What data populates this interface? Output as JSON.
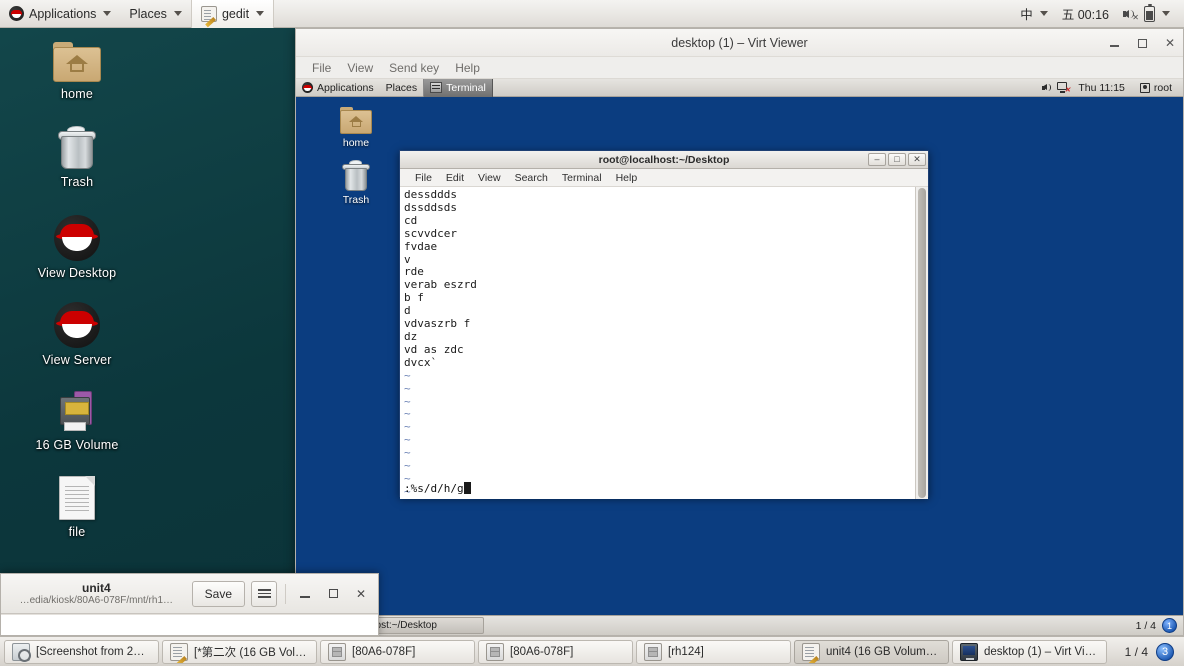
{
  "host_panel": {
    "logo_icon": "redhat-logo-icon",
    "applications": "Applications",
    "places": "Places",
    "active_app": "gedit",
    "ime": "中",
    "clock": "五 00:16",
    "speaker_icon": "speaker-muted-icon",
    "battery_icon": "battery-icon"
  },
  "desktop_icons": [
    {
      "label": "home",
      "icon": "home-folder-icon"
    },
    {
      "label": "Trash",
      "icon": "trash-icon"
    },
    {
      "label": "View Desktop",
      "icon": "redhat-logo-icon"
    },
    {
      "label": "View Server",
      "icon": "redhat-logo-icon"
    },
    {
      "label": "16 GB Volume",
      "icon": "usb-volume-icon"
    },
    {
      "label": "file",
      "icon": "text-file-icon"
    }
  ],
  "virt_viewer": {
    "title": "desktop (1) – Virt Viewer",
    "menu": [
      "File",
      "View",
      "Send key",
      "Help"
    ],
    "buttons": {
      "minimize": "–",
      "maximize": "□",
      "close": "✕"
    }
  },
  "vm": {
    "panel": {
      "applications": "Applications",
      "places": "Places",
      "active_window": "Terminal",
      "clock": "Thu 11:15",
      "user": "root",
      "speaker_icon": "speaker-icon",
      "network_icon": "network-disconnected-icon",
      "user_icon": "user-icon"
    },
    "desktop_icons": [
      {
        "label": "home",
        "icon": "home-folder-icon"
      },
      {
        "label": "Trash",
        "icon": "trash-icon"
      }
    ],
    "terminal": {
      "title": "root@localhost:~/Desktop",
      "menu": [
        "File",
        "Edit",
        "View",
        "Search",
        "Terminal",
        "Help"
      ],
      "buttons": {
        "minimize": "–",
        "maximize": "□",
        "close": "✕"
      },
      "lines": [
        "dessddds",
        "dssddsds",
        "cd",
        "scvvdcer",
        "fvdae",
        "v",
        "rde",
        "verab eszrd",
        "b f",
        "d",
        "vdvaszrb f",
        "dz",
        "vd as zdc",
        "dvcx`"
      ],
      "empty_markers": [
        "~",
        "~",
        "~",
        "~",
        "~",
        "~",
        "~",
        "~",
        "~",
        "~"
      ],
      "command_line": ":%s/d/h/g"
    },
    "taskbar": {
      "window_label": "root@localhost:~/Desktop",
      "window_icon": "terminal-icon",
      "pager": "1 / 4",
      "workspace_badge": "1"
    }
  },
  "gedit": {
    "title": "unit4",
    "subtitle": "…edia/kiosk/80A6-078F/mnt/rh1…",
    "save_label": "Save",
    "menu_icon": "hamburger-menu-icon",
    "buttons": {
      "minimize": "–",
      "maximize": "□",
      "close": "✕"
    }
  },
  "host_taskbar": {
    "items": [
      {
        "label": "[Screenshot from 20…",
        "icon": "screenshot-icon",
        "selected": false
      },
      {
        "label": "[*第二次 (16 GB Vol…",
        "icon": "gedit-icon",
        "selected": false
      },
      {
        "label": "[80A6-078F]",
        "icon": "drive-icon",
        "selected": false
      },
      {
        "label": "[80A6-078F]",
        "icon": "drive-icon",
        "selected": false
      },
      {
        "label": "[rh124]",
        "icon": "drive-icon",
        "selected": false
      },
      {
        "label": "unit4 (16 GB Volum…",
        "icon": "gedit-icon",
        "selected": true
      },
      {
        "label": "desktop (1) – Virt Vi…",
        "icon": "monitor-icon",
        "selected": false
      }
    ],
    "pager": "1 / 4",
    "workspace_badge": "3"
  },
  "colors": {
    "host_wallpaper": "#0d3b3f",
    "vm_wallpaper": "#0b3d80",
    "panel_bg": "#e9e7e3",
    "accent_blue": "#1a56b0",
    "terminal_bg": "#ffffff",
    "terminal_fg": "#1a1a1a"
  }
}
